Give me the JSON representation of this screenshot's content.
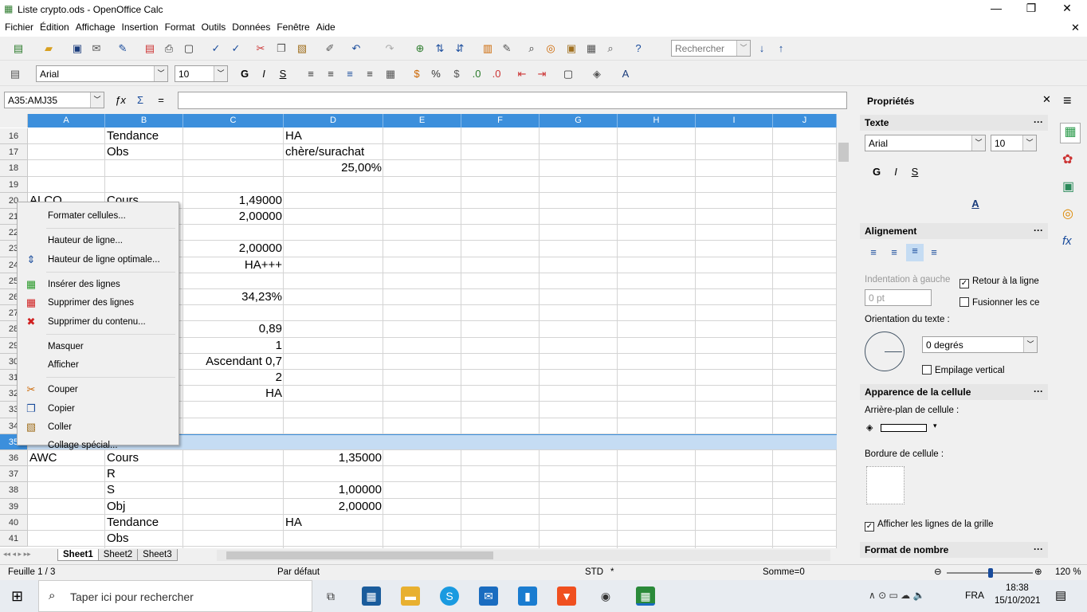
{
  "window": {
    "title": "Liste crypto.ods - OpenOffice Calc",
    "minimize": "—",
    "maximize": "❐",
    "close": "✕",
    "doc_close": "✕"
  },
  "menu": [
    "Fichier",
    "Édition",
    "Affichage",
    "Insertion",
    "Format",
    "Outils",
    "Données",
    "Fenêtre",
    "Aide"
  ],
  "toolbar": {
    "search_placeholder": "Rechercher",
    "font": "Arial",
    "size": "10",
    "bold": "G",
    "italic": "I",
    "underline": "S"
  },
  "formula": {
    "name_box": "A35:AMJ35",
    "value": ""
  },
  "columns": [
    "A",
    "B",
    "C",
    "D",
    "E",
    "F",
    "G",
    "H",
    "I",
    "J"
  ],
  "rows": [
    {
      "n": "16",
      "cells": {
        "B": "Tendance",
        "D": "HA"
      }
    },
    {
      "n": "17",
      "cells": {
        "B": "Obs",
        "D": "chère/surachat"
      }
    },
    {
      "n": "18",
      "cells": {
        "D": "25,00%"
      }
    },
    {
      "n": "19",
      "cells": {}
    },
    {
      "n": "20",
      "cells": {
        "A": "ALCO",
        "B": "Cours",
        "C": "1,49000"
      }
    },
    {
      "n": "21",
      "cells": {
        "C": "2,00000"
      }
    },
    {
      "n": "22",
      "cells": {}
    },
    {
      "n": "23",
      "cells": {
        "C": "2,00000"
      }
    },
    {
      "n": "24",
      "cells": {
        "C": "HA+++"
      }
    },
    {
      "n": "25",
      "cells": {}
    },
    {
      "n": "26",
      "cells": {
        "C": "34,23%"
      }
    },
    {
      "n": "27",
      "cells": {}
    },
    {
      "n": "28",
      "cells": {
        "C": "0,89"
      }
    },
    {
      "n": "29",
      "cells": {
        "C": "1"
      }
    },
    {
      "n": "30",
      "cells": {
        "C": "Ascendant 0,7"
      }
    },
    {
      "n": "31",
      "cells": {
        "C": "2"
      }
    },
    {
      "n": "32",
      "cells": {
        "C": "HA"
      }
    },
    {
      "n": "33",
      "cells": {}
    },
    {
      "n": "34",
      "cells": {}
    },
    {
      "n": "35",
      "cells": {},
      "selected": true
    },
    {
      "n": "36",
      "cells": {
        "A": "AWC",
        "B": "Cours",
        "D": "1,35000"
      }
    },
    {
      "n": "37",
      "cells": {
        "B": "R"
      }
    },
    {
      "n": "38",
      "cells": {
        "B": "S",
        "D": "1,00000"
      }
    },
    {
      "n": "39",
      "cells": {
        "B": "Obj",
        "D": "2,00000"
      }
    },
    {
      "n": "40",
      "cells": {
        "B": "Tendance",
        "D": "HA"
      }
    },
    {
      "n": "41",
      "cells": {
        "B": "Obs"
      }
    }
  ],
  "context_menu": [
    {
      "label": "Formater cellules...",
      "icon": ""
    },
    {
      "sep": true
    },
    {
      "label": "Hauteur de ligne...",
      "icon": ""
    },
    {
      "label": "Hauteur de ligne optimale...",
      "icon": "row-height-icon"
    },
    {
      "sep": true
    },
    {
      "label": "Insérer des lignes",
      "icon": "insert-rows-icon"
    },
    {
      "label": "Supprimer des lignes",
      "icon": "delete-rows-icon"
    },
    {
      "label": "Supprimer du contenu...",
      "icon": "delete-contents-icon"
    },
    {
      "sep": true
    },
    {
      "label": "Masquer",
      "icon": ""
    },
    {
      "label": "Afficher",
      "icon": ""
    },
    {
      "sep": true
    },
    {
      "label": "Couper",
      "icon": "cut-icon"
    },
    {
      "label": "Copier",
      "icon": "copy-icon"
    },
    {
      "label": "Coller",
      "icon": "paste-icon"
    },
    {
      "label": "Collage spécial...",
      "icon": ""
    }
  ],
  "sidebar": {
    "title": "Propriétés",
    "texte": "Texte",
    "font": "Arial",
    "size": "10",
    "alignement": "Alignement",
    "indent_label": "Indentation à gauche",
    "indent_value": "0 pt",
    "wrap": "Retour à la ligne",
    "merge": "Fusionner les ce",
    "orientation": "Orientation du texte :",
    "degrees": "0 degrés",
    "stack": "Empilage vertical",
    "apparence": "Apparence de la cellule",
    "bg": "Arrière-plan de cellule :",
    "border": "Bordure de cellule :",
    "gridlines": "Afficher les lignes de la grille",
    "format": "Format de nombre"
  },
  "sheets": [
    "Sheet1",
    "Sheet2",
    "Sheet3"
  ],
  "status": {
    "sheet": "Feuille 1 / 3",
    "style": "Par défaut",
    "mode": "STD",
    "star": "*",
    "sum": "Somme=0",
    "zoom": "120 %"
  },
  "taskbar": {
    "search": "Taper ici pour rechercher",
    "lang": "FRA",
    "time": "18:38",
    "date": "15/10/2021"
  },
  "colors": {
    "accent": "#3c8fdc",
    "selection": "#c5dcf3"
  }
}
